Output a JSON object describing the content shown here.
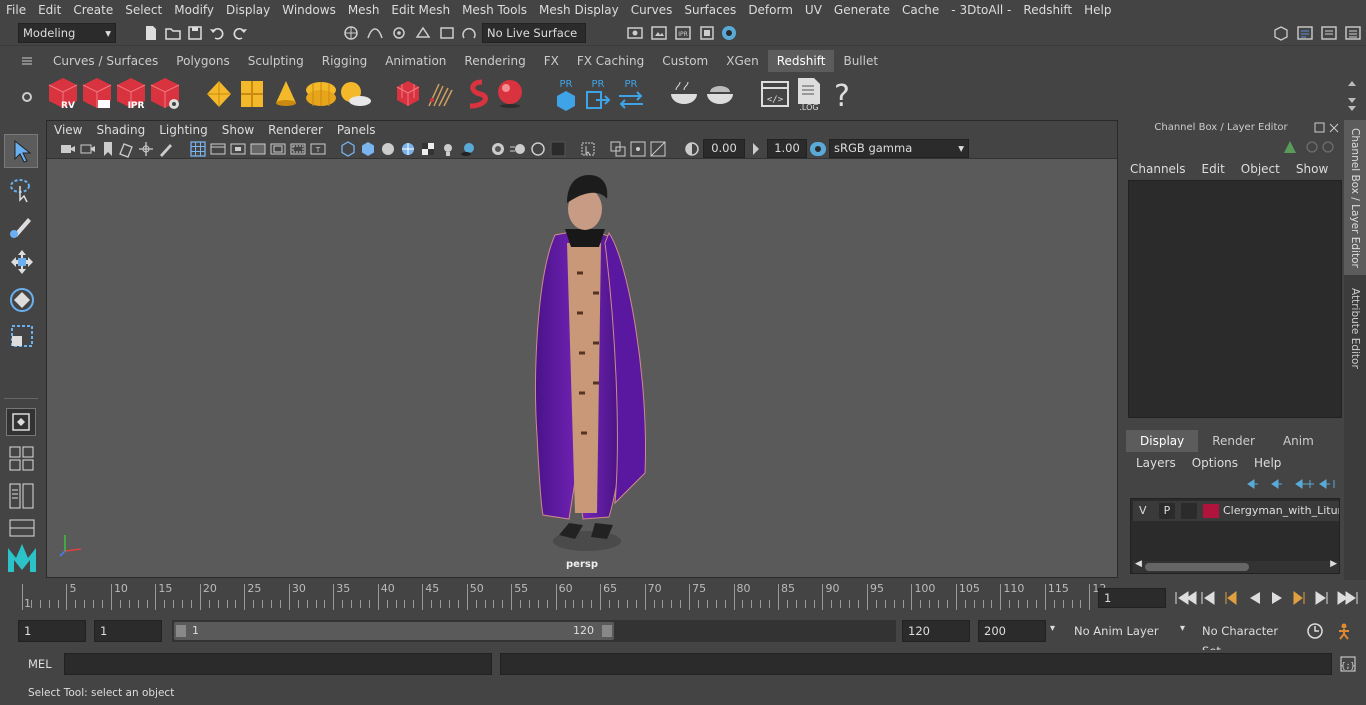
{
  "menu": [
    "File",
    "Edit",
    "Create",
    "Select",
    "Modify",
    "Display",
    "Windows",
    "Mesh",
    "Edit Mesh",
    "Mesh Tools",
    "Mesh Display",
    "Curves",
    "Surfaces",
    "Deform",
    "UV",
    "Generate",
    "Cache",
    "- 3DtoAll -",
    "Redshift",
    "Help"
  ],
  "status": {
    "mode": "Modeling",
    "live_surface": "No Live Surface"
  },
  "shelf_tabs": [
    "Curves / Surfaces",
    "Polygons",
    "Sculpting",
    "Rigging",
    "Animation",
    "Rendering",
    "FX",
    "FX Caching",
    "Custom",
    "XGen",
    "Redshift",
    "Bullet"
  ],
  "shelf_active": "Redshift",
  "shelf_labels": {
    "rv": "RV",
    "ipr": "IPR",
    "pr1": "PR",
    "pr2": "PR",
    "pr3": "PR",
    "log": ".LOG"
  },
  "viewport": {
    "menus": [
      "View",
      "Shading",
      "Lighting",
      "Show",
      "Renderer",
      "Panels"
    ],
    "exposure": "0.00",
    "gamma": "1.00",
    "colorspace": "sRGB gamma",
    "camera": "persp"
  },
  "channel_box": {
    "title": "Channel Box / Layer Editor",
    "menus": [
      "Channels",
      "Edit",
      "Object",
      "Show"
    ],
    "layer_tabs": [
      "Display",
      "Render",
      "Anim"
    ],
    "layer_tab_active": "Display",
    "layer_menus": [
      "Layers",
      "Options",
      "Help"
    ],
    "layer": {
      "v": "V",
      "p": "P",
      "name": "Clergyman_with_Liturg",
      "color": "#b0143c"
    }
  },
  "side_tabs": {
    "channel": "Channel Box / Layer Editor",
    "attr": "Attribute Editor"
  },
  "timeline": {
    "ticks": [
      "5",
      "10",
      "15",
      "20",
      "25",
      "30",
      "35",
      "40",
      "45",
      "50",
      "55",
      "60",
      "65",
      "70",
      "75",
      "80",
      "85",
      "90",
      "95",
      "100",
      "105",
      "110",
      "115",
      "12"
    ],
    "start_mark": "1",
    "current_frame": "1"
  },
  "range": {
    "start": "1",
    "playback_start": "1",
    "slider_start": "1",
    "slider_end": "120",
    "playback_end": "120",
    "end": "200",
    "anim_layer": "No Anim Layer",
    "char_set": "No Character Set"
  },
  "cmd": {
    "lang": "MEL"
  },
  "help": {
    "text": "Select Tool: select an object"
  },
  "colors": {
    "accent": "#5c8fd6",
    "robe": "#6a1fa8",
    "active_tab": "#5c5c5c"
  }
}
